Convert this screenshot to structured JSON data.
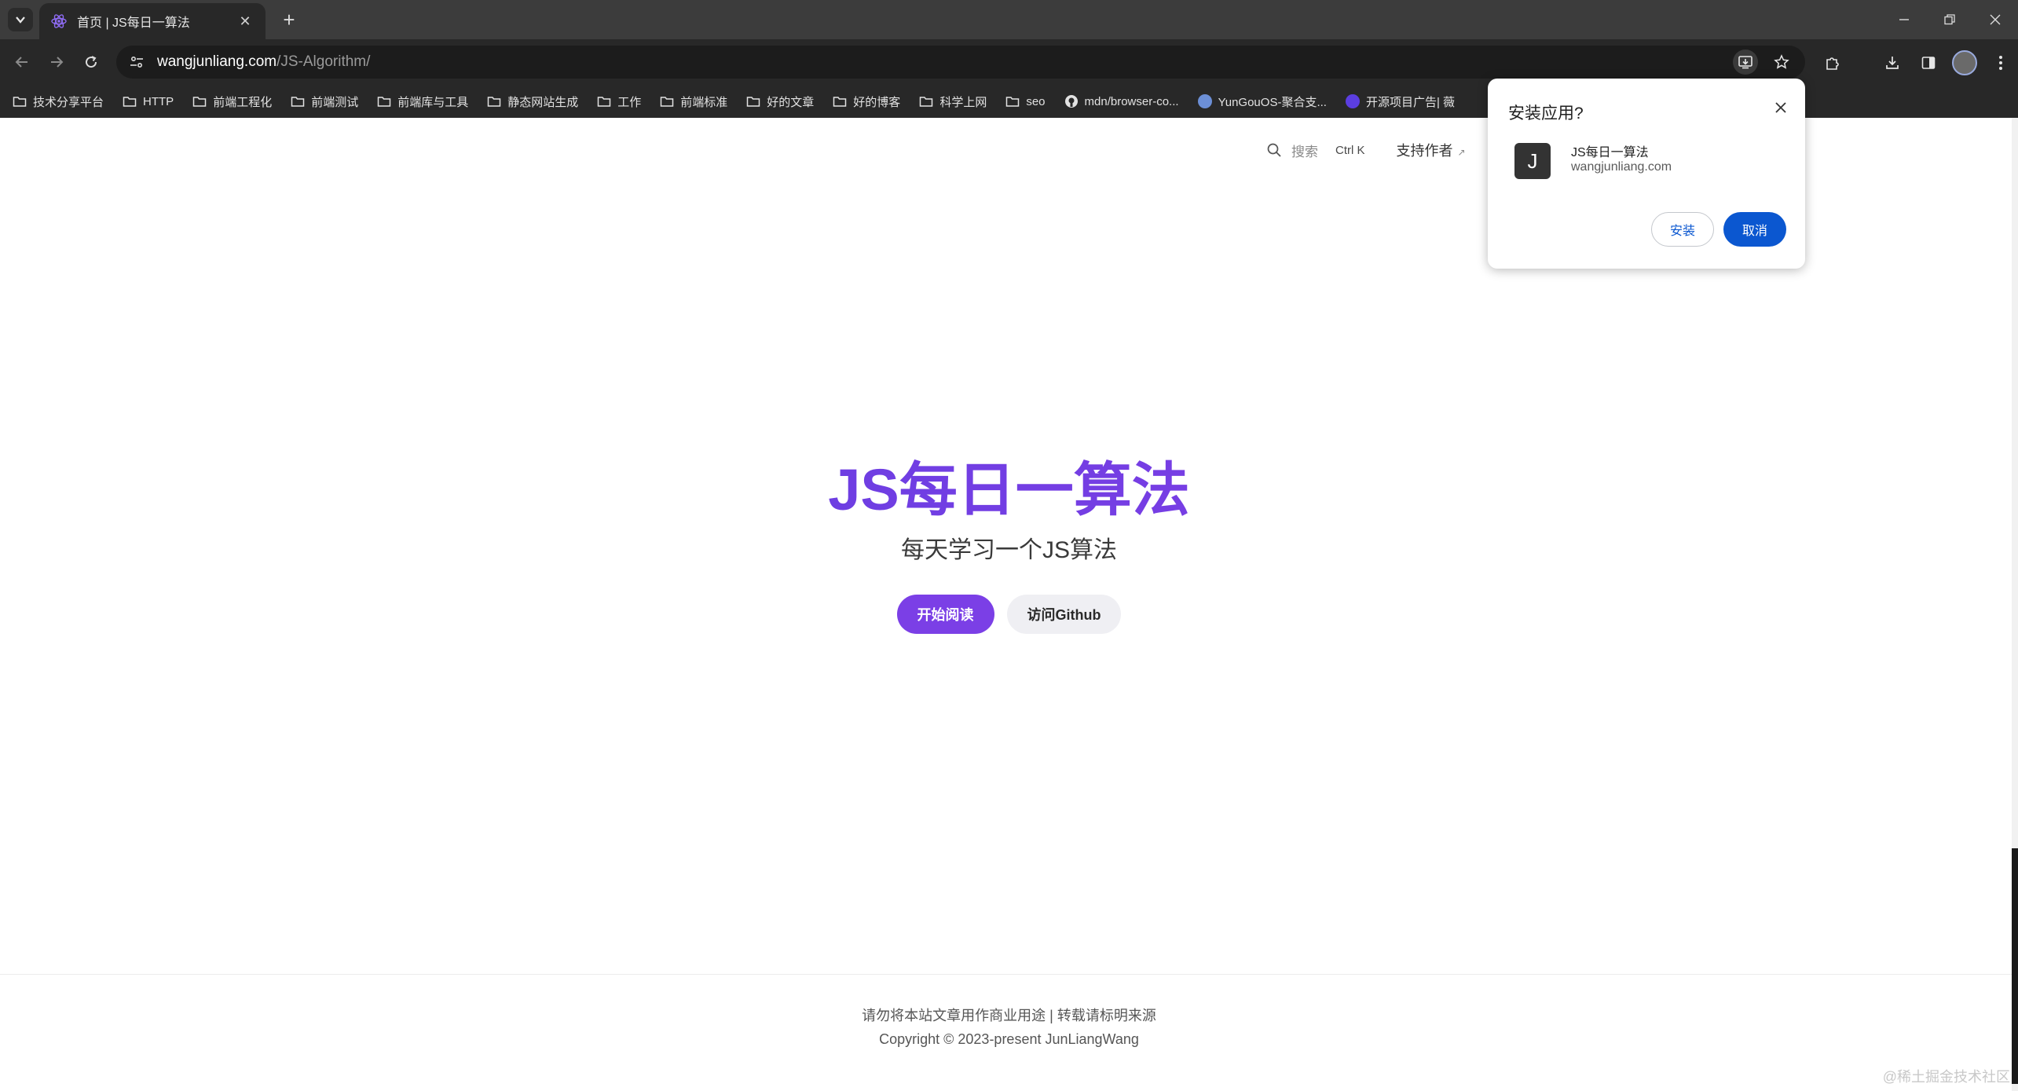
{
  "browser": {
    "tab": {
      "title": "首页 | JS每日一算法",
      "close": "✕"
    },
    "new_tab": "+",
    "address": {
      "host": "wangjunliang.com",
      "path": "/JS-Algorithm/"
    },
    "bookmarks": [
      {
        "label": "技术分享平台",
        "kind": "folder"
      },
      {
        "label": "HTTP",
        "kind": "folder"
      },
      {
        "label": "前端工程化",
        "kind": "folder"
      },
      {
        "label": "前端测试",
        "kind": "folder"
      },
      {
        "label": "前端库与工具",
        "kind": "folder"
      },
      {
        "label": "静态网站生成",
        "kind": "folder"
      },
      {
        "label": "工作",
        "kind": "folder"
      },
      {
        "label": "前端标准",
        "kind": "folder"
      },
      {
        "label": "好的文章",
        "kind": "folder"
      },
      {
        "label": "好的博客",
        "kind": "folder"
      },
      {
        "label": "科学上网",
        "kind": "folder"
      },
      {
        "label": "seo",
        "kind": "folder"
      },
      {
        "label": "mdn/browser-co...",
        "kind": "github"
      },
      {
        "label": "YunGouOS-聚合支...",
        "kind": "site"
      },
      {
        "label": "开源项目广告| 薇",
        "kind": "site"
      }
    ]
  },
  "site_nav": {
    "search_label": "搜索",
    "shortcut": "Ctrl K",
    "support_label": "支持作者",
    "support_ext": "↗"
  },
  "hero": {
    "title": "JS每日一算法",
    "tagline": "每天学习一个JS算法",
    "primary_action": "开始阅读",
    "secondary_action": "访问Github"
  },
  "footer": {
    "message": "请勿将本站文章用作商业用途 | 转载请标明来源",
    "copyright": "Copyright © 2023-present JunLiangWang"
  },
  "watermark": "@稀土掘金技术社区",
  "install_prompt": {
    "title": "安装应用?",
    "app_icon_letter": "J",
    "app_name": "JS每日一算法",
    "app_origin": "wangjunliang.com",
    "install_label": "安装",
    "cancel_label": "取消"
  },
  "colors": {
    "accent": "#7b3fe6",
    "chrome_bg": "#282828",
    "popup_primary": "#0b57d0"
  }
}
